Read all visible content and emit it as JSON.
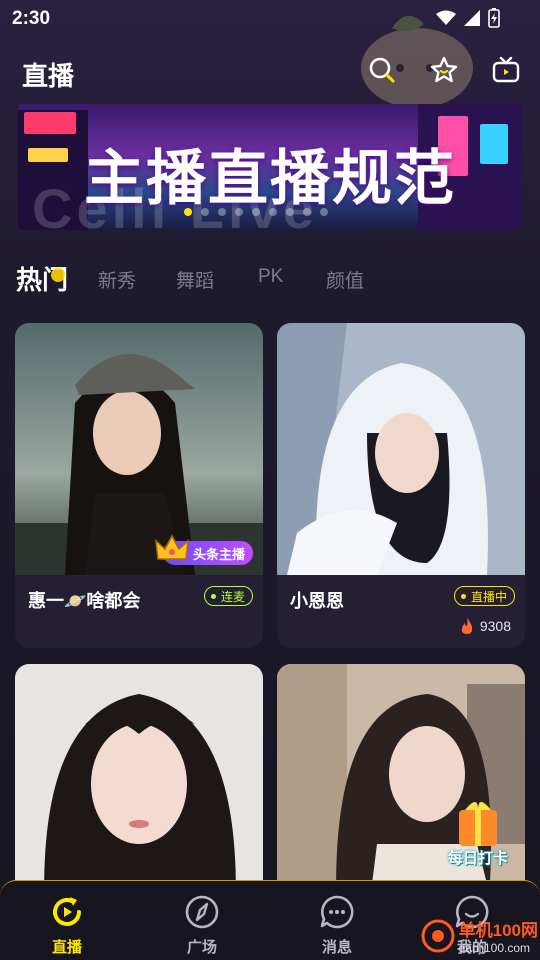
{
  "status_bar": {
    "time": "2:30"
  },
  "header": {
    "title": "直播"
  },
  "banner": {
    "title": "主播直播规范",
    "watermark": "Celli Live",
    "dot_count": 9,
    "active_dot": 0
  },
  "tabs": [
    {
      "label": "热门",
      "active": true
    },
    {
      "label": "新秀",
      "active": false
    },
    {
      "label": "舞蹈",
      "active": false
    },
    {
      "label": "PK",
      "active": false
    },
    {
      "label": "颜值",
      "active": false
    }
  ],
  "cards": [
    {
      "name": "惠一🪐啥都会",
      "badge": "连麦",
      "tag": "头条主播"
    },
    {
      "name": "小恩恩",
      "badge": "直播中",
      "viewers": "9308"
    },
    {
      "name": ""
    },
    {
      "name": "",
      "checkin_label": "每日打卡"
    }
  ],
  "nav": [
    {
      "label": "直播",
      "active": true
    },
    {
      "label": "广场",
      "active": false
    },
    {
      "label": "消息",
      "active": false
    },
    {
      "label": "我的",
      "active": false
    }
  ],
  "watermark": {
    "brand": "单机100网",
    "url": "danji100.com"
  },
  "colors": {
    "accent": "#ffe600",
    "link_badge": "#b6ff3c",
    "background": "#1e1a2e"
  }
}
